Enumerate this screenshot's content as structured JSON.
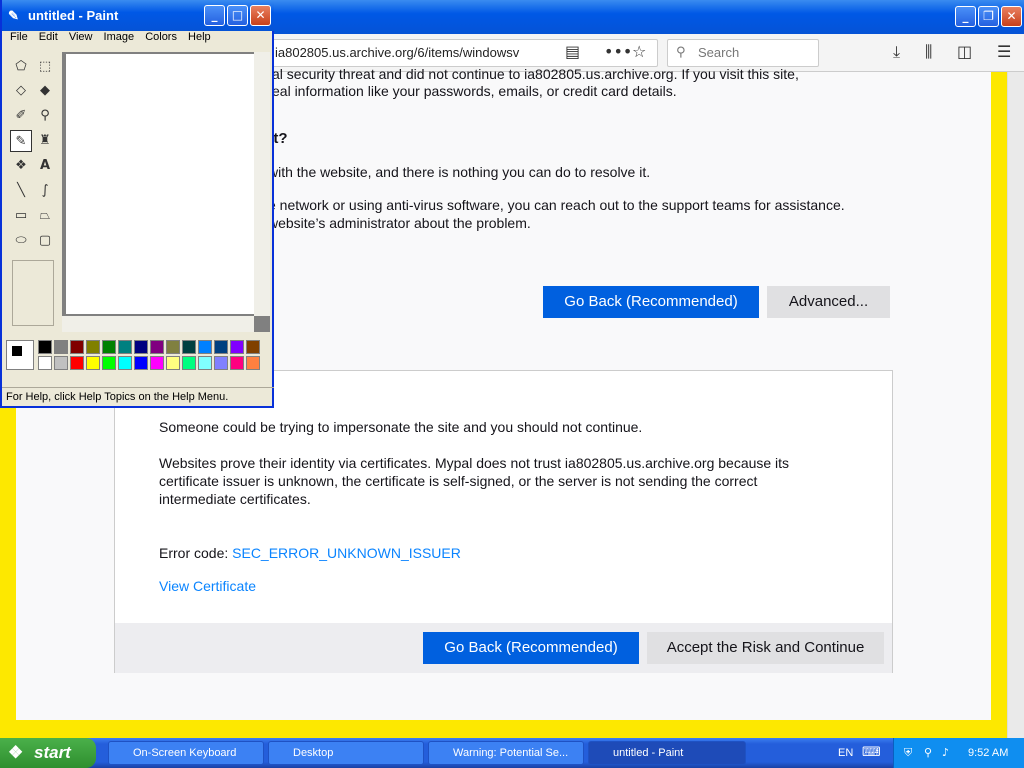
{
  "browser": {
    "url": "ia802805.us.archive.org/6/items/windowsv",
    "search_placeholder": "Search",
    "frag1": "al security threat and did not continue to ia802805.us.archive.org. If you visit this site,",
    "frag2": "eal information like your passwords, emails, or credit card details.",
    "heading": "t it?",
    "frag3": "with the website, and there is nothing you can do to resolve it.",
    "frag4": "e network or using anti-virus software, you can reach out to the support teams for assistance.",
    "frag5": "website’s administrator about the problem.",
    "go_back": "Go Back (Recommended)",
    "advanced": "Advanced...",
    "adv_p1": "Someone could be trying to impersonate the site and you should not continue.",
    "adv_p2a": "Websites prove their identity via certificates. Mypal does not trust ia802805.us.archive.org because its",
    "adv_p2b": "certificate issuer is unknown, the certificate is self-signed, or the server is not sending the correct",
    "adv_p2c": "intermediate certificates.",
    "error_label": "Error code: ",
    "error_code": "SEC_ERROR_UNKNOWN_ISSUER",
    "view_cert": "View Certificate",
    "go_back2": "Go Back (Recommended)",
    "accept": "Accept the Risk and Continue"
  },
  "paint": {
    "title": "untitled - Paint",
    "menu": [
      "File",
      "Edit",
      "View",
      "Image",
      "Colors",
      "Help"
    ],
    "status": "For Help, click Help Topics on the Help Menu."
  },
  "taskbar": {
    "start": "start",
    "tasks": [
      "On-Screen Keyboard",
      "Desktop",
      "Warning: Potential Se...",
      "untitled - Paint"
    ],
    "lang": "EN",
    "time": "9:52 AM"
  }
}
